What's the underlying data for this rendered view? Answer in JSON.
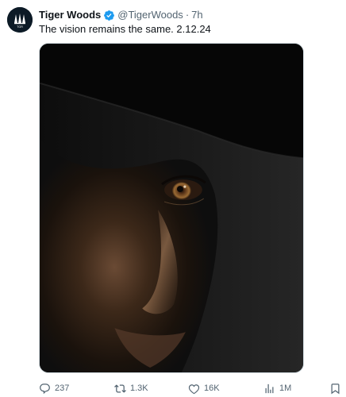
{
  "author": {
    "name": "Tiger Woods",
    "handle": "@TigerWoods",
    "separator": "·",
    "time": "7h",
    "avatar_label": "TGR"
  },
  "tweet": {
    "text": "The vision remains the same. 2.12.24"
  },
  "metrics": {
    "replies": "237",
    "retweets": "1.3K",
    "likes": "16K",
    "views": "1M"
  },
  "colors": {
    "verified": "#1d9bf0",
    "text_primary": "#0f1419",
    "text_secondary": "#536471",
    "avatar_bg": "#0c1a26"
  },
  "icons": {
    "verified": "verified-badge-icon",
    "reply": "reply-icon",
    "retweet": "retweet-icon",
    "like": "heart-icon",
    "views": "views-chart-icon",
    "bookmark": "bookmark-icon"
  }
}
